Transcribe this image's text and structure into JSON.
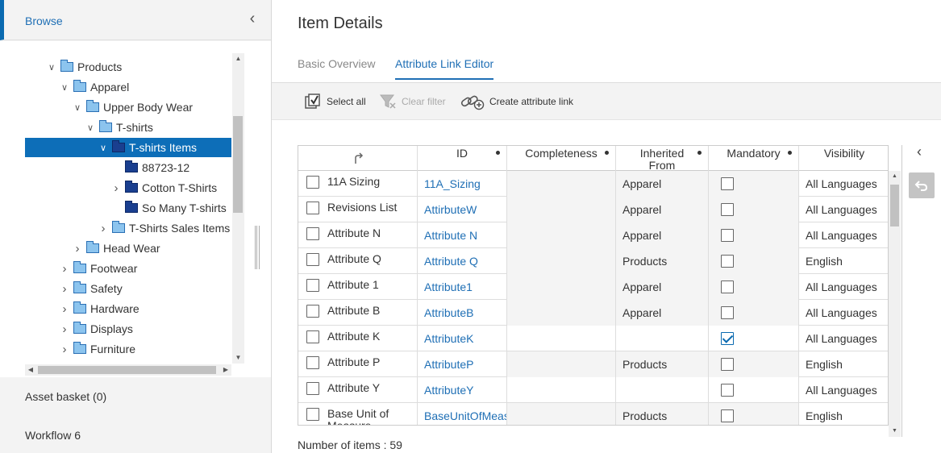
{
  "sidebar": {
    "title": "Browse",
    "tree": [
      {
        "label": "Products",
        "level": 0,
        "chevron": "down",
        "folder": "light"
      },
      {
        "label": "Apparel",
        "level": 1,
        "chevron": "down",
        "folder": "light"
      },
      {
        "label": "Upper Body Wear",
        "level": 2,
        "chevron": "down",
        "folder": "light"
      },
      {
        "label": "T-shirts",
        "level": 3,
        "chevron": "down",
        "folder": "light"
      },
      {
        "label": "T-shirts Items",
        "level": 4,
        "chevron": "down",
        "folder": "dark",
        "selected": true
      },
      {
        "label": "88723-12",
        "level": 5,
        "chevron": "",
        "folder": "dark"
      },
      {
        "label": "Cotton T-Shirts",
        "level": 5,
        "chevron": "right",
        "folder": "dark"
      },
      {
        "label": "So Many T-shirts",
        "level": 5,
        "chevron": "",
        "folder": "dark"
      },
      {
        "label": "T-Shirts Sales Items",
        "level": 4,
        "chevron": "right",
        "folder": "light"
      },
      {
        "label": "Head Wear",
        "level": 2,
        "chevron": "right",
        "folder": "light"
      },
      {
        "label": "Footwear",
        "level": 1,
        "chevron": "right",
        "folder": "light"
      },
      {
        "label": "Safety",
        "level": 1,
        "chevron": "right",
        "folder": "light"
      },
      {
        "label": "Hardware",
        "level": 1,
        "chevron": "right",
        "folder": "light"
      },
      {
        "label": "Displays",
        "level": 1,
        "chevron": "right",
        "folder": "light"
      },
      {
        "label": "Furniture",
        "level": 1,
        "chevron": "right",
        "folder": "light"
      }
    ],
    "asset_basket": "Asset basket (0)",
    "workflow": "Workflow 6"
  },
  "main": {
    "title": "Item Details",
    "tabs": [
      {
        "label": "Basic Overview",
        "active": false
      },
      {
        "label": "Attribute Link Editor",
        "active": true
      }
    ],
    "toolbar": {
      "select_all": "Select all",
      "clear_filter": "Clear filter",
      "create_link": "Create attribute link"
    },
    "table": {
      "columns": [
        "",
        "ID",
        "Completeness",
        "Inherited From",
        "Mandatory",
        "Visibility"
      ],
      "rows": [
        {
          "name": "11A Sizing",
          "id": "11A_Sizing",
          "inherited": "Apparel",
          "mandatory": false,
          "visibility": "All Languages"
        },
        {
          "name": "Revisions List",
          "id": "AttirbuteW",
          "inherited": "Apparel",
          "mandatory": false,
          "visibility": "All Languages"
        },
        {
          "name": "Attribute N",
          "id": "Attribute N",
          "inherited": "Apparel",
          "mandatory": false,
          "visibility": "All Languages"
        },
        {
          "name": "Attribute Q",
          "id": "Attribute Q",
          "inherited": "Products",
          "mandatory": false,
          "visibility": "English"
        },
        {
          "name": "Attribute 1",
          "id": "Attribute1",
          "inherited": "Apparel",
          "mandatory": false,
          "visibility": "All Languages"
        },
        {
          "name": "Attribute B",
          "id": "AttributeB",
          "inherited": "Apparel",
          "mandatory": false,
          "visibility": "All Languages"
        },
        {
          "name": "Attribute K",
          "id": "AttributeK",
          "inherited": "",
          "mandatory": true,
          "visibility": "All Languages"
        },
        {
          "name": "Attribute P",
          "id": "AttributeP",
          "inherited": "Products",
          "mandatory": false,
          "visibility": "English"
        },
        {
          "name": "Attribute Y",
          "id": "AttributeY",
          "inherited": "",
          "mandatory": false,
          "visibility": "All Languages"
        },
        {
          "name": "Base Unit of Measure",
          "id": "BaseUnitOfMeasure",
          "inherited": "Products",
          "mandatory": false,
          "visibility": "English"
        }
      ]
    },
    "item_count": "Number of items : 59"
  }
}
